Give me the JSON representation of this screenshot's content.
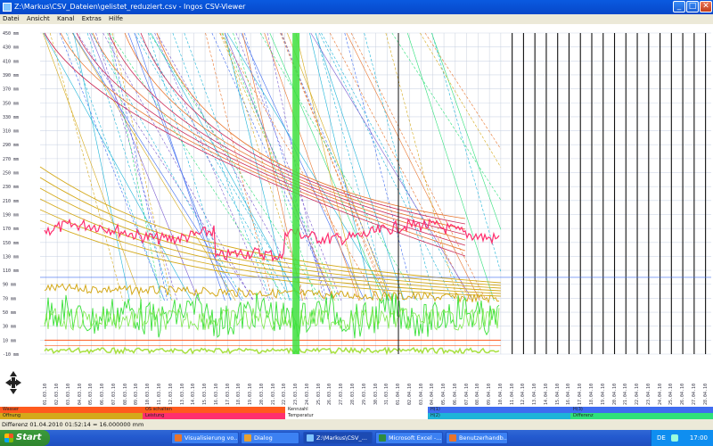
{
  "window": {
    "title": "Z:\\Markus\\CSV_Dateien\\gelistet_reduziert.csv - Ingos CSV-Viewer"
  },
  "menu": [
    "Datei",
    "Ansicht",
    "Kanal",
    "Extras",
    "Hilfe"
  ],
  "winbuttons": {
    "min": "_",
    "max": "□",
    "close": "✕"
  },
  "chart_data": {
    "type": "line",
    "title": "",
    "y_axis_unit": "mm",
    "ylim": [
      -10,
      450
    ],
    "y_ticks": [
      -10,
      10,
      30,
      50,
      70,
      90,
      110,
      130,
      150,
      170,
      190,
      210,
      230,
      250,
      270,
      290,
      310,
      330,
      350,
      370,
      390,
      410,
      430,
      450
    ],
    "x_ticks": [
      "01.03.10",
      "02.03.10",
      "03.03.10",
      "04.03.10",
      "05.03.10",
      "06.03.10",
      "07.03.10",
      "08.03.10",
      "09.03.10",
      "10.03.10",
      "11.03.10",
      "12.03.10",
      "13.03.10",
      "14.03.10",
      "15.03.10",
      "16.03.10",
      "17.03.10",
      "18.03.10",
      "19.03.10",
      "20.03.10",
      "21.03.10",
      "22.03.10",
      "23.03.10",
      "24.03.10",
      "25.03.10",
      "26.03.10",
      "27.03.10",
      "28.03.10",
      "29.03.10",
      "30.03.10",
      "31.03.10",
      "01.04.10",
      "02.04.10",
      "03.04.10",
      "04.04.10",
      "05.04.10",
      "06.04.10",
      "07.04.10",
      "08.04.10",
      "09.04.10",
      "10.04.10",
      "11.04.10",
      "12.04.10",
      "13.04.10",
      "14.04.10",
      "15.04.10",
      "16.04.10",
      "17.04.10",
      "18.04.10",
      "19.04.10",
      "20.04.10",
      "21.04.10",
      "22.04.10",
      "23.04.10",
      "24.04.10",
      "25.04.10",
      "26.04.10",
      "27.04.10",
      "28.04.10"
    ],
    "series": [
      {
        "name": "Wasser",
        "color": "#ff5a1e"
      },
      {
        "name": "Öffnung",
        "color": "#d4a91a"
      },
      {
        "name": "OS schalten",
        "color": "#ff5a1e"
      },
      {
        "name": "Leistung",
        "color": "#ff2f6e"
      },
      {
        "name": "Kennzahl",
        "color": "#ffffff"
      },
      {
        "name": "Temperatur",
        "color": "#ffffff"
      },
      {
        "name": "H(1)",
        "color": "#3f6cf0"
      },
      {
        "name": "H(2)",
        "color": "#1eb4d8"
      },
      {
        "name": "H(3)",
        "color": "#3f6cf0"
      },
      {
        "name": "Differenz",
        "color": "#2fe07a"
      }
    ]
  },
  "status": {
    "text": "Differenz 01.04.2010 01:52:14 = 16.000000 mm"
  },
  "taskbar": {
    "start": "Start",
    "items": [
      {
        "label": "Visualisierung vo...",
        "color": "#e8742c"
      },
      {
        "label": "Dialog",
        "color": "#e8a030"
      },
      {
        "label": "Z:\\Markus\\CSV_...",
        "color": "#7ec4ff"
      },
      {
        "label": "Microsoft Excel -...",
        "color": "#2e8b3e"
      },
      {
        "label": "Benutzerhandb...",
        "color": "#e8742c"
      }
    ],
    "tray": {
      "lang": "DE",
      "time": "17:00"
    }
  }
}
